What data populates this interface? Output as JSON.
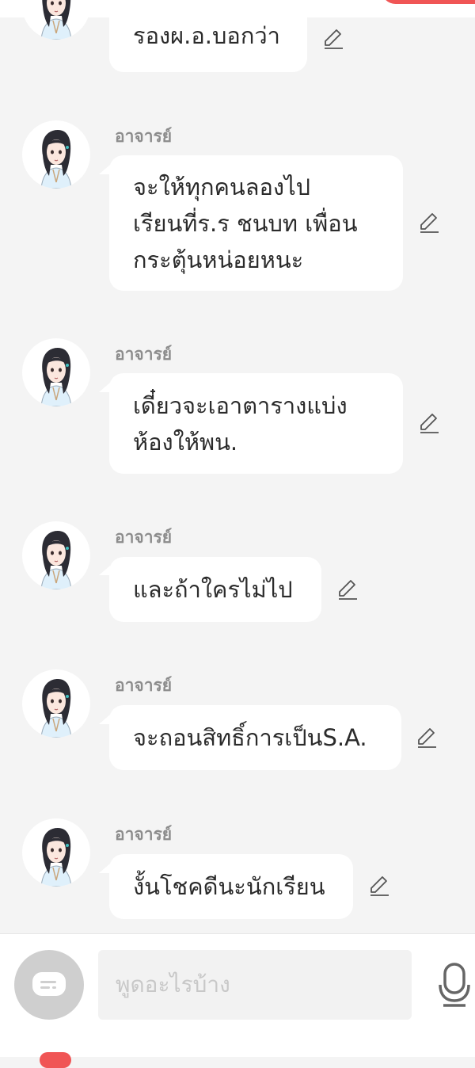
{
  "chat": {
    "messages": [
      {
        "sender": "",
        "text": "รองผ.อ.บอกว่า"
      },
      {
        "sender": "อาจารย์",
        "text": "จะให้ทุกคนลองไป\nเรียนที่ร.ร ชนบท เพื่อน\nกระตุ้นหน่อยหนะ"
      },
      {
        "sender": "อาจารย์",
        "text": "เดี๋ยวจะเอาตารางแบ่ง\nห้องให้พน."
      },
      {
        "sender": "อาจารย์",
        "text": "และถ้าใครไม่ไป"
      },
      {
        "sender": "อาจารย์",
        "text": "จะถอนสิทธิ์การเป็นS.A."
      },
      {
        "sender": "อาจารย์",
        "text": "งั้นโชคดีนะนักเรียน"
      }
    ]
  },
  "input": {
    "placeholder": "พูดอะไรบ้าง"
  },
  "icons": {
    "edit": "pencil-icon",
    "chat_toggle": "chat-bubble-icon",
    "mic": "microphone-icon"
  },
  "colors": {
    "accent": "#f05555",
    "background": "#f4f4f4",
    "sender": "#8c8c8c"
  }
}
